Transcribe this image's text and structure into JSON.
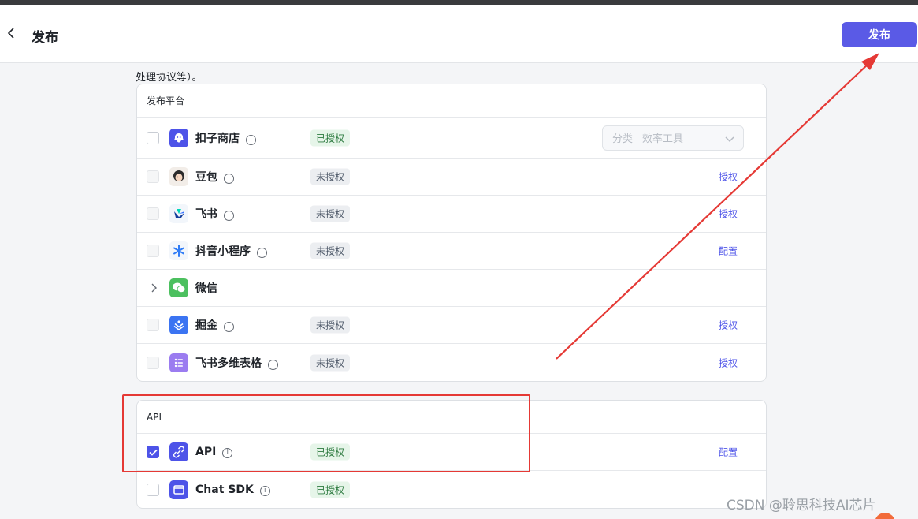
{
  "header": {
    "title": "发布",
    "publish_label": "发布"
  },
  "intro_text": "处理协议等）。",
  "platforms": {
    "title": "发布平台",
    "items": [
      {
        "name": "扣子商店",
        "status": "已授权",
        "status_type": "ok",
        "checkbox": "unchecked",
        "icon": "coze-store-icon",
        "category_label": "分类",
        "category_value": "效率工具"
      },
      {
        "name": "豆包",
        "status": "未授权",
        "status_type": "no",
        "checkbox": "disabled",
        "icon": "doubao-icon",
        "action": "授权"
      },
      {
        "name": "飞书",
        "status": "未授权",
        "status_type": "no",
        "checkbox": "disabled",
        "icon": "feishu-icon",
        "action": "授权"
      },
      {
        "name": "抖音小程序",
        "status": "未授权",
        "status_type": "no",
        "checkbox": "disabled",
        "icon": "douyin-miniapp-icon",
        "action": "配置"
      },
      {
        "name": "微信",
        "icon": "wechat-icon",
        "expandable": true
      },
      {
        "name": "掘金",
        "status": "未授权",
        "status_type": "no",
        "checkbox": "disabled",
        "icon": "juejin-icon",
        "action": "授权"
      },
      {
        "name": "飞书多维表格",
        "status": "未授权",
        "status_type": "no",
        "checkbox": "disabled",
        "icon": "feishu-bitable-icon",
        "action": "授权"
      }
    ]
  },
  "api_section": {
    "title": "API",
    "items": [
      {
        "name": "API",
        "status": "已授权",
        "status_type": "ok",
        "checkbox": "checked",
        "icon": "api-icon",
        "action": "配置"
      },
      {
        "name": "Chat SDK",
        "status": "已授权",
        "status_type": "ok",
        "checkbox": "unchecked",
        "icon": "chat-sdk-icon"
      }
    ]
  },
  "watermark": "CSDN @聆思科技AI芯片",
  "colors": {
    "accent": "#4d53e8",
    "publish_button": "#5a5ae6",
    "annotation": "#e53935"
  }
}
